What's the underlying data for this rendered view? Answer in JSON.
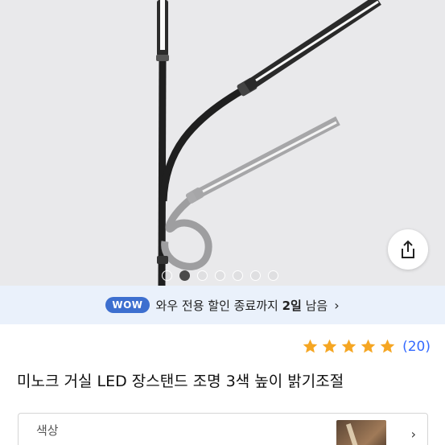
{
  "hero": {
    "carousel_count": 7,
    "carousel_active": 2
  },
  "share": {
    "icon": "share-icon"
  },
  "promo": {
    "badge": "WOW",
    "text_prefix": "와우 전용 할인 종료까지 ",
    "text_days": "2일",
    "text_suffix": " 남음",
    "chevron": "›"
  },
  "rating": {
    "stars": 5,
    "count": "(20)",
    "star_color": "#f5a623"
  },
  "product": {
    "title": "미노크 거실 LED 장스탠드 조명 3색 높이 밝기조절"
  },
  "option": {
    "label": "색상"
  },
  "colors": {
    "accent": "#346aff",
    "wow_badge": "#3d6fcf",
    "promo_bg": "#eaf1fb"
  }
}
